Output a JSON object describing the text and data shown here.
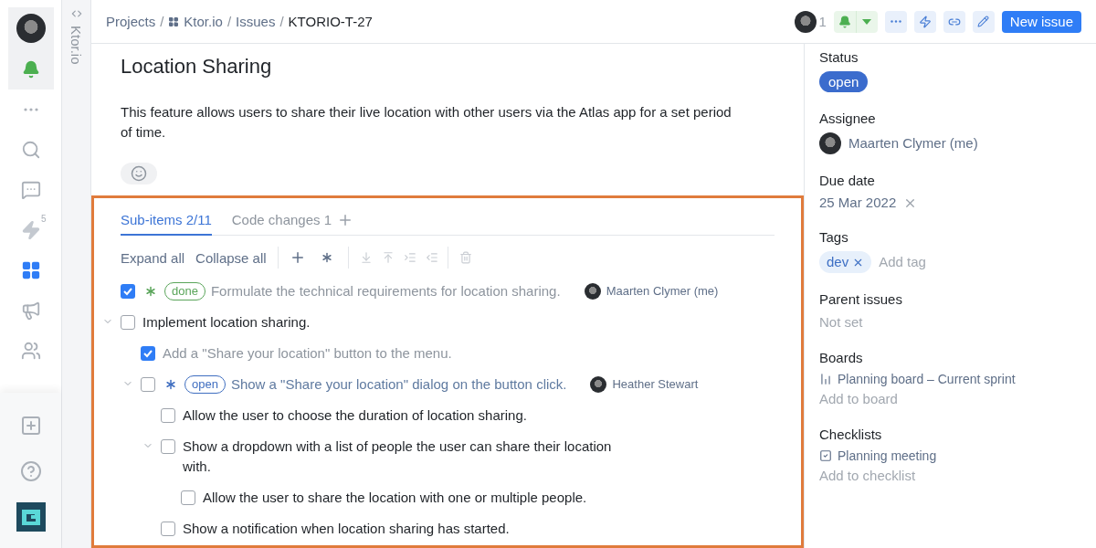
{
  "project": {
    "name": "Ktor.io"
  },
  "nav": [
    {
      "kind": "profile",
      "selected": true
    },
    {
      "kind": "bell",
      "selected": true
    },
    {
      "kind": "more",
      "selected": false
    },
    {
      "kind": "search",
      "selected": false
    },
    {
      "kind": "chat",
      "selected": false
    },
    {
      "kind": "automation",
      "selected": false,
      "count": "5"
    },
    {
      "kind": "apps",
      "selected": false
    },
    {
      "kind": "announcements",
      "selected": false
    },
    {
      "kind": "team",
      "selected": false
    }
  ],
  "nav_bottom": [
    {
      "kind": "add"
    },
    {
      "kind": "help"
    },
    {
      "kind": "logo"
    }
  ],
  "breadcrumbs": [
    {
      "kind": "link",
      "text": "Projects",
      "separator": "/"
    },
    {
      "kind": "project",
      "text": "Ktor.io",
      "separator": "/"
    },
    {
      "kind": "link",
      "text": "Issues",
      "separator": "/"
    },
    {
      "kind": "current",
      "text": "KTORIO-T-27"
    }
  ],
  "header": {
    "watchers": "1",
    "notifications_on": true,
    "button": "New issue"
  },
  "issue": {
    "title": "Location Sharing",
    "description": "This feature allows users to share their live location with other users via the Atlas app for a set period of time."
  },
  "tabs": [
    {
      "label": "Sub-items 2/11",
      "selected": true
    },
    {
      "label": "Code changes 1",
      "selected": false
    }
  ],
  "toolbar": {
    "links": [
      "Expand all",
      "Collapse all"
    ],
    "groups": [
      [
        {
          "kind": "add",
          "disabled": false
        },
        {
          "kind": "subtask",
          "disabled": false
        }
      ],
      [
        {
          "kind": "move-down",
          "disabled": true
        },
        {
          "kind": "move-up",
          "disabled": true
        },
        {
          "kind": "indent",
          "disabled": true
        },
        {
          "kind": "outdent",
          "disabled": true
        }
      ],
      [
        {
          "kind": "delete",
          "disabled": true
        }
      ]
    ]
  },
  "sub_items": [
    {
      "kind": "issue",
      "text": "Formulate the technical requirements for location sharing.",
      "checked": true,
      "status": "done",
      "color": "#5aa55a",
      "assignee": "Maarten Clymer (me)"
    },
    {
      "kind": "task",
      "text": "Implement location sharing.",
      "checked": false,
      "expanded": true,
      "children": [
        {
          "kind": "task",
          "text": "Add a \"Share your location\" button to the menu.",
          "checked": true
        },
        {
          "kind": "issue",
          "text": "Show a \"Share your location\" dialog on the button click.",
          "checked": false,
          "status": "open",
          "color": "#3f6ec0",
          "assignee": "Heather Stewart",
          "expanded": true,
          "children": [
            {
              "kind": "task",
              "text": "Allow the user to choose the duration of location sharing.",
              "checked": false
            },
            {
              "kind": "task",
              "text": "Show a dropdown with a list of people the user can share their location with.",
              "checked": false,
              "expanded": true,
              "children": [
                {
                  "kind": "task",
                  "text": "Allow the user to share the location with one or multiple people.",
                  "checked": false
                }
              ]
            },
            {
              "kind": "task",
              "text": "Show a notification when location sharing has started.",
              "checked": false
            }
          ]
        }
      ]
    }
  ],
  "fields": [
    {
      "kind": "status",
      "label": "Status",
      "value": "open"
    },
    {
      "kind": "user",
      "label": "Assignee",
      "value": "Maarten Clymer (me)"
    },
    {
      "kind": "date",
      "label": "Due date",
      "value": "25 Mar 2022"
    },
    {
      "kind": "tags",
      "label": "Tags",
      "tags": [
        "dev"
      ],
      "add": "Add tag"
    },
    {
      "kind": "empty",
      "label": "Parent issues",
      "value": "Not set"
    },
    {
      "kind": "board",
      "label": "Boards",
      "value": "Planning board – Current sprint",
      "add": "Add to board"
    },
    {
      "kind": "checklist",
      "label": "Checklists",
      "value": "Planning meeting",
      "add": "Add to checklist"
    }
  ]
}
